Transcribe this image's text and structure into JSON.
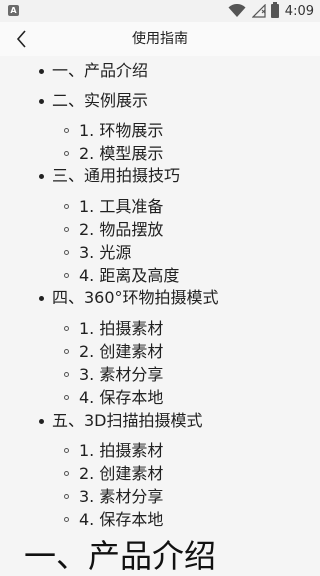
{
  "statusbar": {
    "app_icon_letter": "A",
    "time": "4:09",
    "icons": [
      "wifi-icon",
      "signal-icon",
      "battery-icon"
    ]
  },
  "header": {
    "back_icon": "chevron-left-icon",
    "title": "使用指南"
  },
  "toc": [
    {
      "label": "一、产品介绍",
      "children": []
    },
    {
      "label": "二、实例展示",
      "children": [
        "1. 环物展示",
        "2. 模型展示"
      ]
    },
    {
      "label": "三、通用拍摄技巧",
      "children": [
        "1. 工具准备",
        "2. 物品摆放",
        "3. 光源",
        "4. 距离及高度"
      ]
    },
    {
      "label": "四、360°环物拍摄模式",
      "children": [
        "1. 拍摄素材",
        "2. 创建素材",
        "3. 素材分享",
        "4. 保存本地"
      ]
    },
    {
      "label": "五、3D扫描拍摄模式",
      "children": [
        "1. 拍摄素材",
        "2. 创建素材",
        "3. 素材分享",
        "4. 保存本地"
      ]
    }
  ],
  "section_heading": "一、产品介绍",
  "colors": {
    "link": "#2a62b4",
    "background": "#f5f5f5"
  }
}
